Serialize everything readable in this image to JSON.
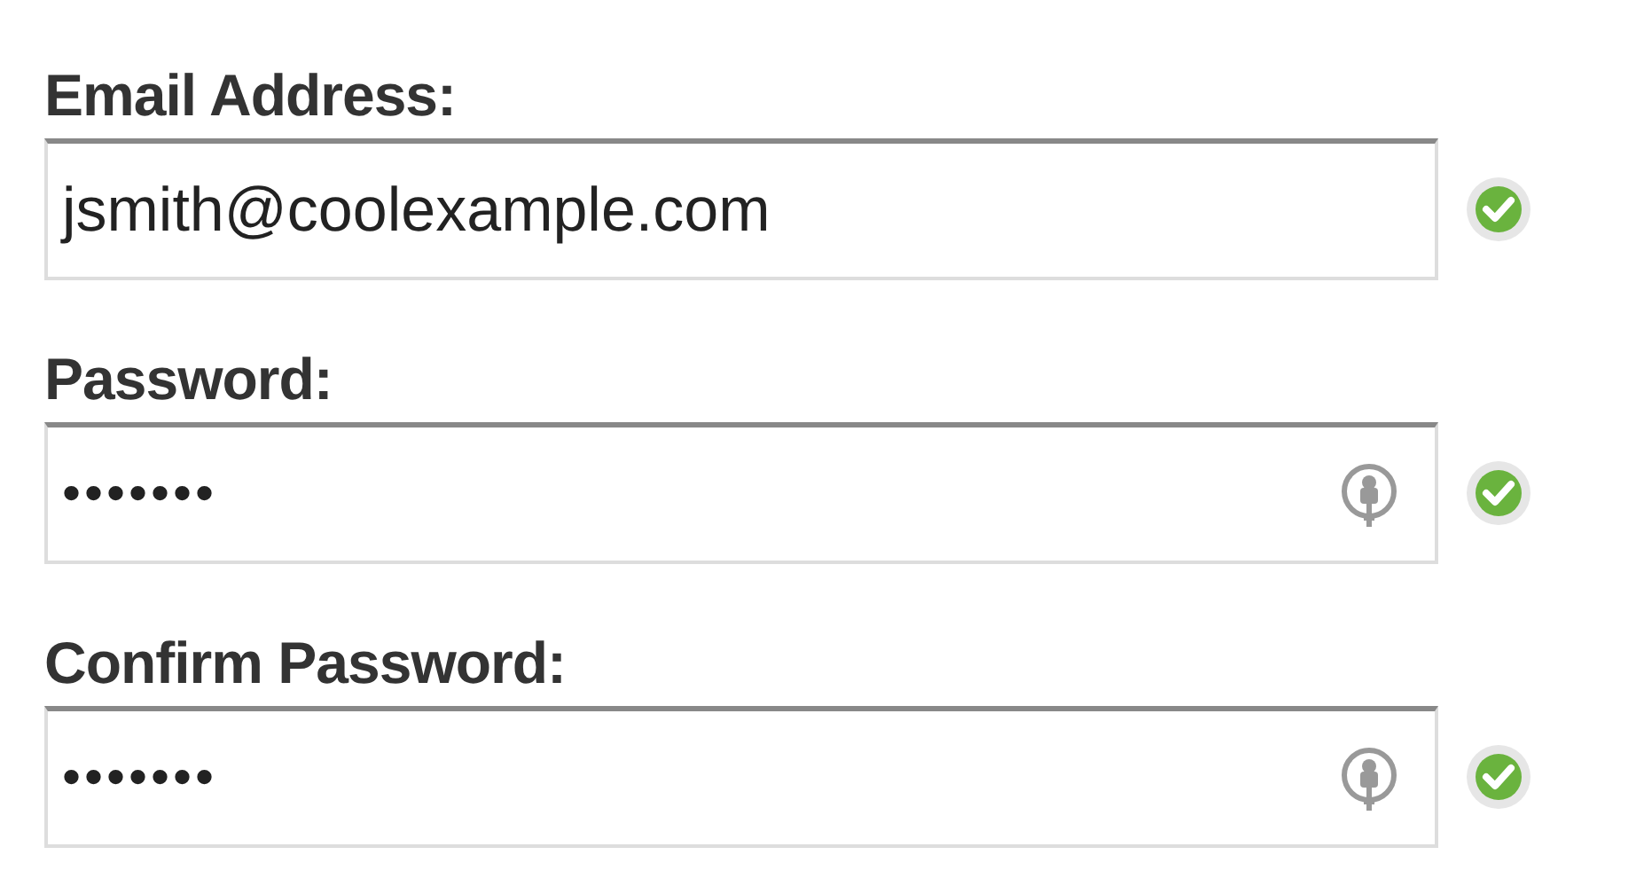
{
  "fields": [
    {
      "label": "Email Address:",
      "value": "jsmith@coolexample.com",
      "key_icon": false,
      "valid": true
    },
    {
      "label": "Password:",
      "value": "•••••••",
      "key_icon": true,
      "valid": true
    },
    {
      "label": "Confirm Password:",
      "value": "•••••••",
      "key_icon": true,
      "valid": true
    }
  ]
}
